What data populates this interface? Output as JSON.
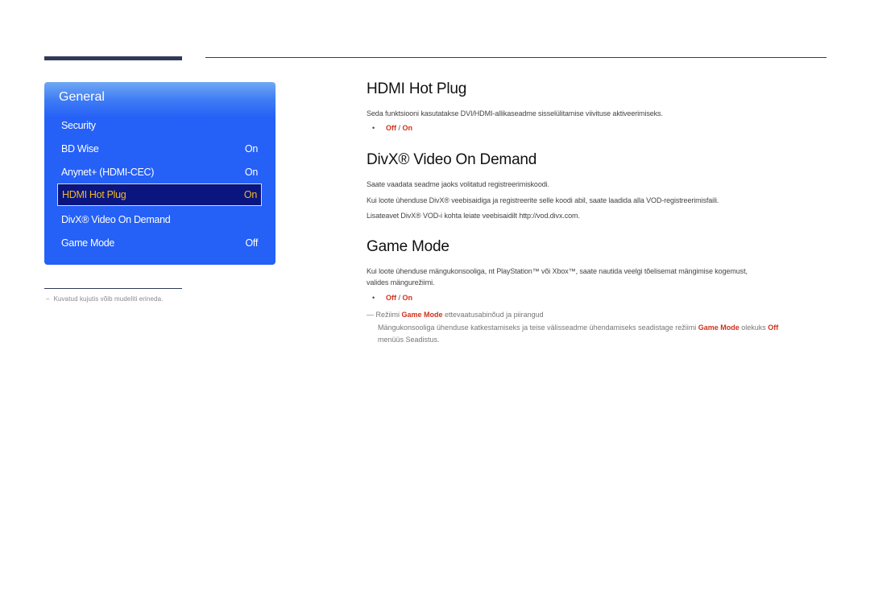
{
  "osd": {
    "title": "General",
    "items": [
      {
        "label": "Security",
        "value": ""
      },
      {
        "label": "BD Wise",
        "value": "On"
      },
      {
        "label": "Anynet+ (HDMI-CEC)",
        "value": "On"
      },
      {
        "label": "HDMI Hot Plug",
        "value": "On",
        "selected": true
      },
      {
        "label": "DivX® Video On Demand",
        "value": ""
      },
      {
        "label": "Game Mode",
        "value": "Off"
      }
    ]
  },
  "footnote": {
    "dash": "–",
    "text": "Kuvatud kujutis võib mudeliti erineda."
  },
  "sections": {
    "hdmi": {
      "title": "HDMI Hot Plug",
      "desc": "Seda funktsiooni kasutatakse DVI/HDMI-allikaseadme sisselülitamise viivituse aktiveerimiseks.",
      "bullet_dot": "•",
      "opt_off": "Off",
      "opt_sep": " / ",
      "opt_on": "On"
    },
    "divx": {
      "title": "DivX® Video On Demand",
      "line1": "Saate vaadata seadme jaoks volitatud registreerimiskoodi.",
      "line2": "Kui loote ühenduse DivX® veebisaidiga ja registreerite selle koodi abil, saate laadida alla VOD-registreerimisfaili.",
      "line3": "Lisateavet DivX® VOD-i kohta leiate veebisaidilt http://vod.divx.com."
    },
    "game": {
      "title": "Game Mode",
      "desc_line1": "Kui loote ühenduse mängukonsooliga, nt PlayStation™ või Xbox™, saate nautida veelgi tõelisemat mängimise kogemust,",
      "desc_line2": "valides mängurežiimi.",
      "bullet_dot": "•",
      "opt_off": "Off",
      "opt_sep": " / ",
      "opt_on": "On",
      "note_dash": "—",
      "note_pre": " Režiimi ",
      "note_accent": "Game Mode",
      "note_post": " ettevaatusabinõud ja piirangud",
      "body_pre": "Mängukonsooliga ühenduse katkestamiseks ja teise välisseadme ühendamiseks seadistage režiimi ",
      "body_accent1": "Game Mode",
      "body_mid": " olekuks ",
      "body_accent2": "Off",
      "body_line2": "menüüs Seadistus."
    }
  },
  "colors": {
    "accent": "#d1301b",
    "osd_blue": "#2560f7",
    "osd_selected_bg": "#0a1580",
    "osd_selected_text": "#f2b824"
  }
}
